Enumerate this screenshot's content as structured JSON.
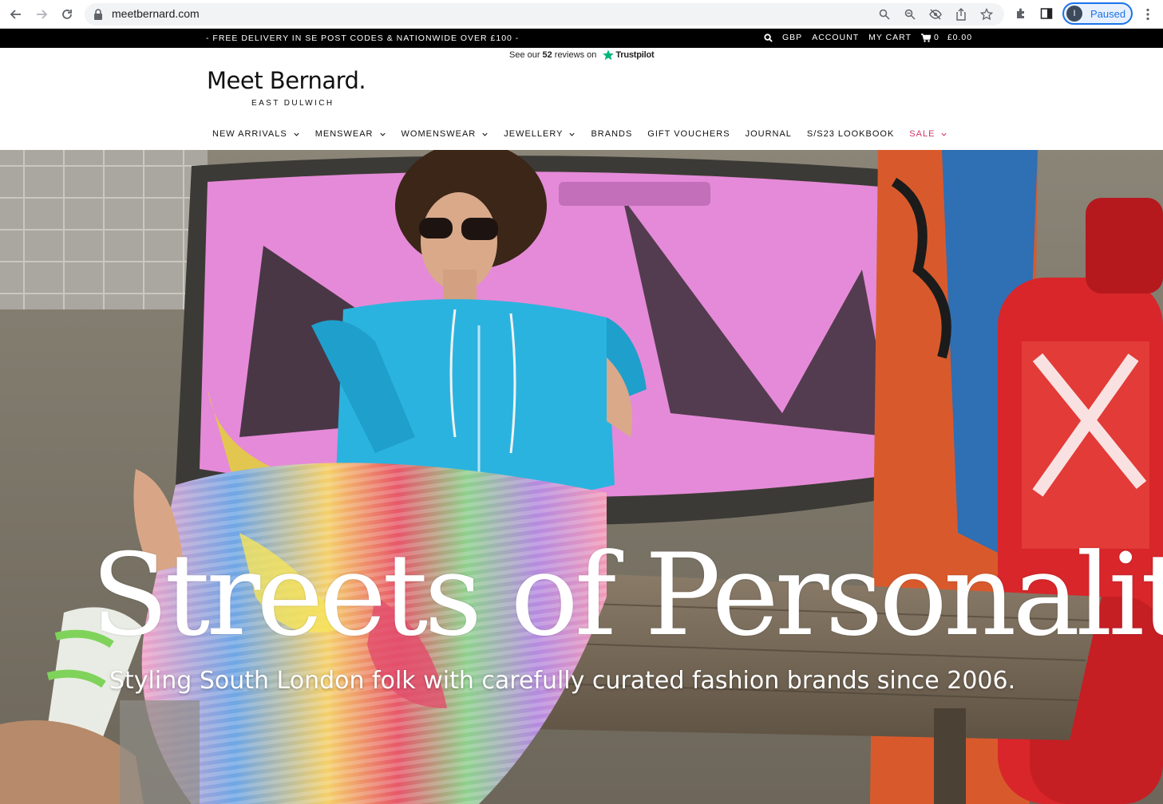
{
  "browser": {
    "url": "meetbernard.com",
    "profile_initial": "I",
    "profile_status": "Paused",
    "icons": [
      "back-icon",
      "forward-icon",
      "reload-icon",
      "lock-icon",
      "search-icon",
      "zoom-icon",
      "eye-off-icon",
      "share-icon",
      "star-icon",
      "extensions-icon",
      "sidepanel-icon",
      "kebab-icon"
    ]
  },
  "announcement": {
    "promo": "- FREE DELIVERY IN SE POST CODES & NATIONWIDE OVER £100 -",
    "currency": "GBP",
    "account": "ACCOUNT",
    "my_cart": "MY CART",
    "cart_count": "0",
    "cart_total": "£0.00"
  },
  "trustpilot": {
    "prefix": "See our",
    "count": "52",
    "suffix": "reviews on",
    "brand": "Trustpilot"
  },
  "logo": {
    "name": "Meet Bernard.",
    "location": "EAST DULWICH"
  },
  "nav": {
    "new_arrivals": "NEW ARRIVALS",
    "menswear": "MENSWEAR",
    "womenswear": "WOMENSWEAR",
    "jewellery": "JEWELLERY",
    "brands": "BRANDS",
    "gift_vouchers": "GIFT VOUCHERS",
    "journal": "JOURNAL",
    "lookbook": "S/S23 LOOKBOOK",
    "sale": "SALE"
  },
  "hero": {
    "title": "Streets of Personality",
    "subtitle": "Styling South London folk with carefully curated fashion brands since 2006."
  },
  "colors": {
    "sale": "#d3366b",
    "trustpilot_green": "#00b67a",
    "chrome_blue": "#1a73e8"
  }
}
